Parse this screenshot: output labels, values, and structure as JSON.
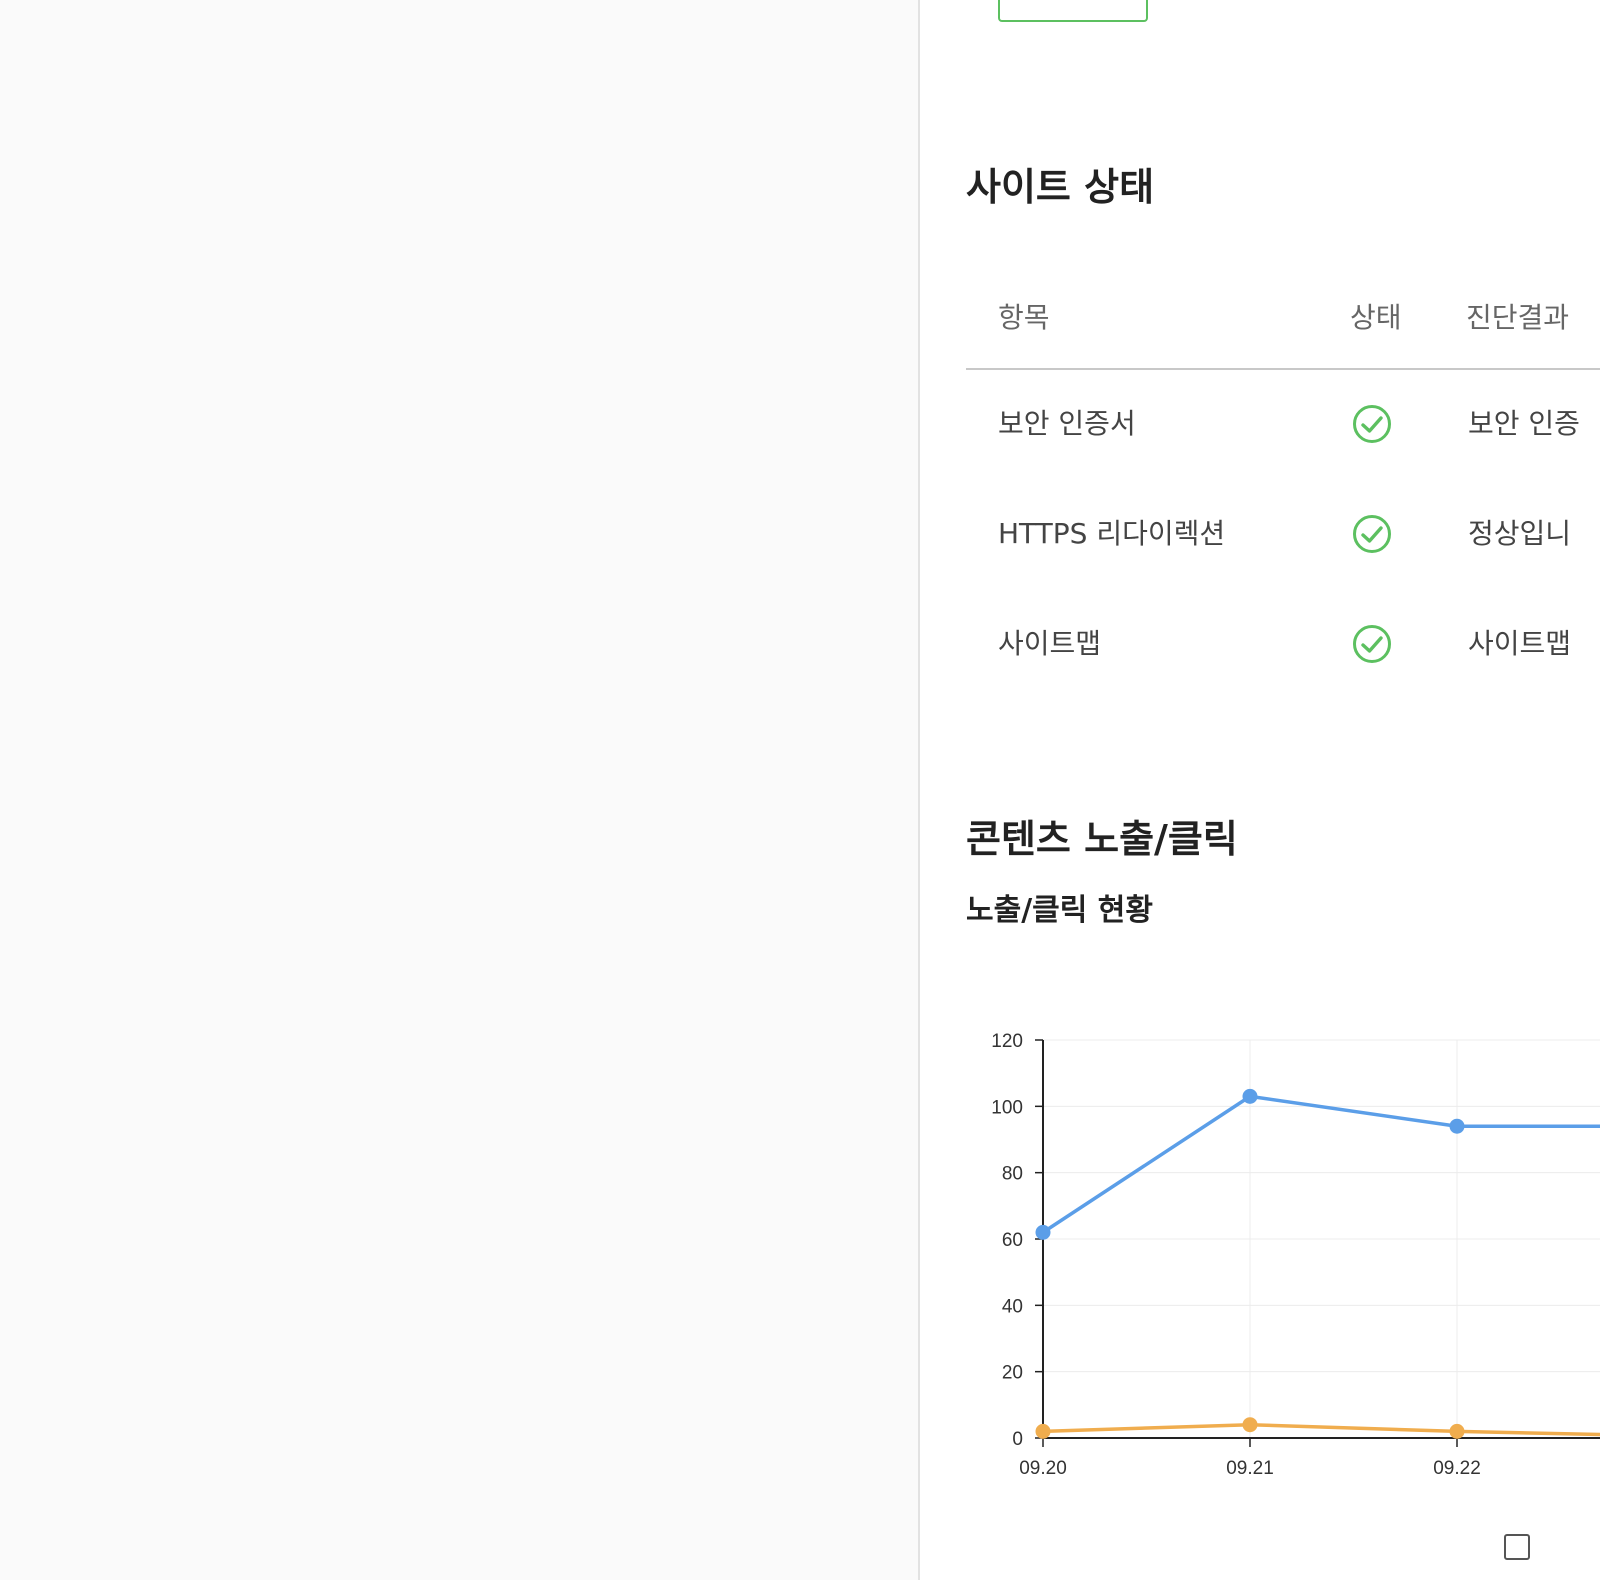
{
  "top_row": {
    "button_label": "",
    "note": ""
  },
  "site_status": {
    "title": "사이트 상태",
    "headers": {
      "item": "항목",
      "state": "상태",
      "result": "진단결과"
    },
    "rows": [
      {
        "item": "보안 인증서",
        "status": "ok",
        "result": "보안 인증"
      },
      {
        "item": "HTTPS 리다이렉션",
        "status": "ok",
        "result": "정상입니"
      },
      {
        "item": "사이트맵",
        "status": "ok",
        "result": "사이트맵"
      }
    ],
    "ok_color": "#5cc060"
  },
  "content": {
    "title": "콘텐츠 노출/클릭",
    "subtitle": "노출/클릭 현황"
  },
  "legend": {
    "first_label": ""
  },
  "chart_data": {
    "type": "line",
    "categories": [
      "09.20",
      "09.21",
      "09.22"
    ],
    "ylim": [
      0,
      120
    ],
    "yticks": [
      0,
      20,
      40,
      60,
      80,
      100,
      120
    ],
    "grid": true,
    "series": [
      {
        "values": [
          62,
          103,
          94
        ],
        "color": "#5b9ee8"
      },
      {
        "values": [
          2,
          4,
          2
        ],
        "color": "#f0ad4e"
      }
    ]
  }
}
